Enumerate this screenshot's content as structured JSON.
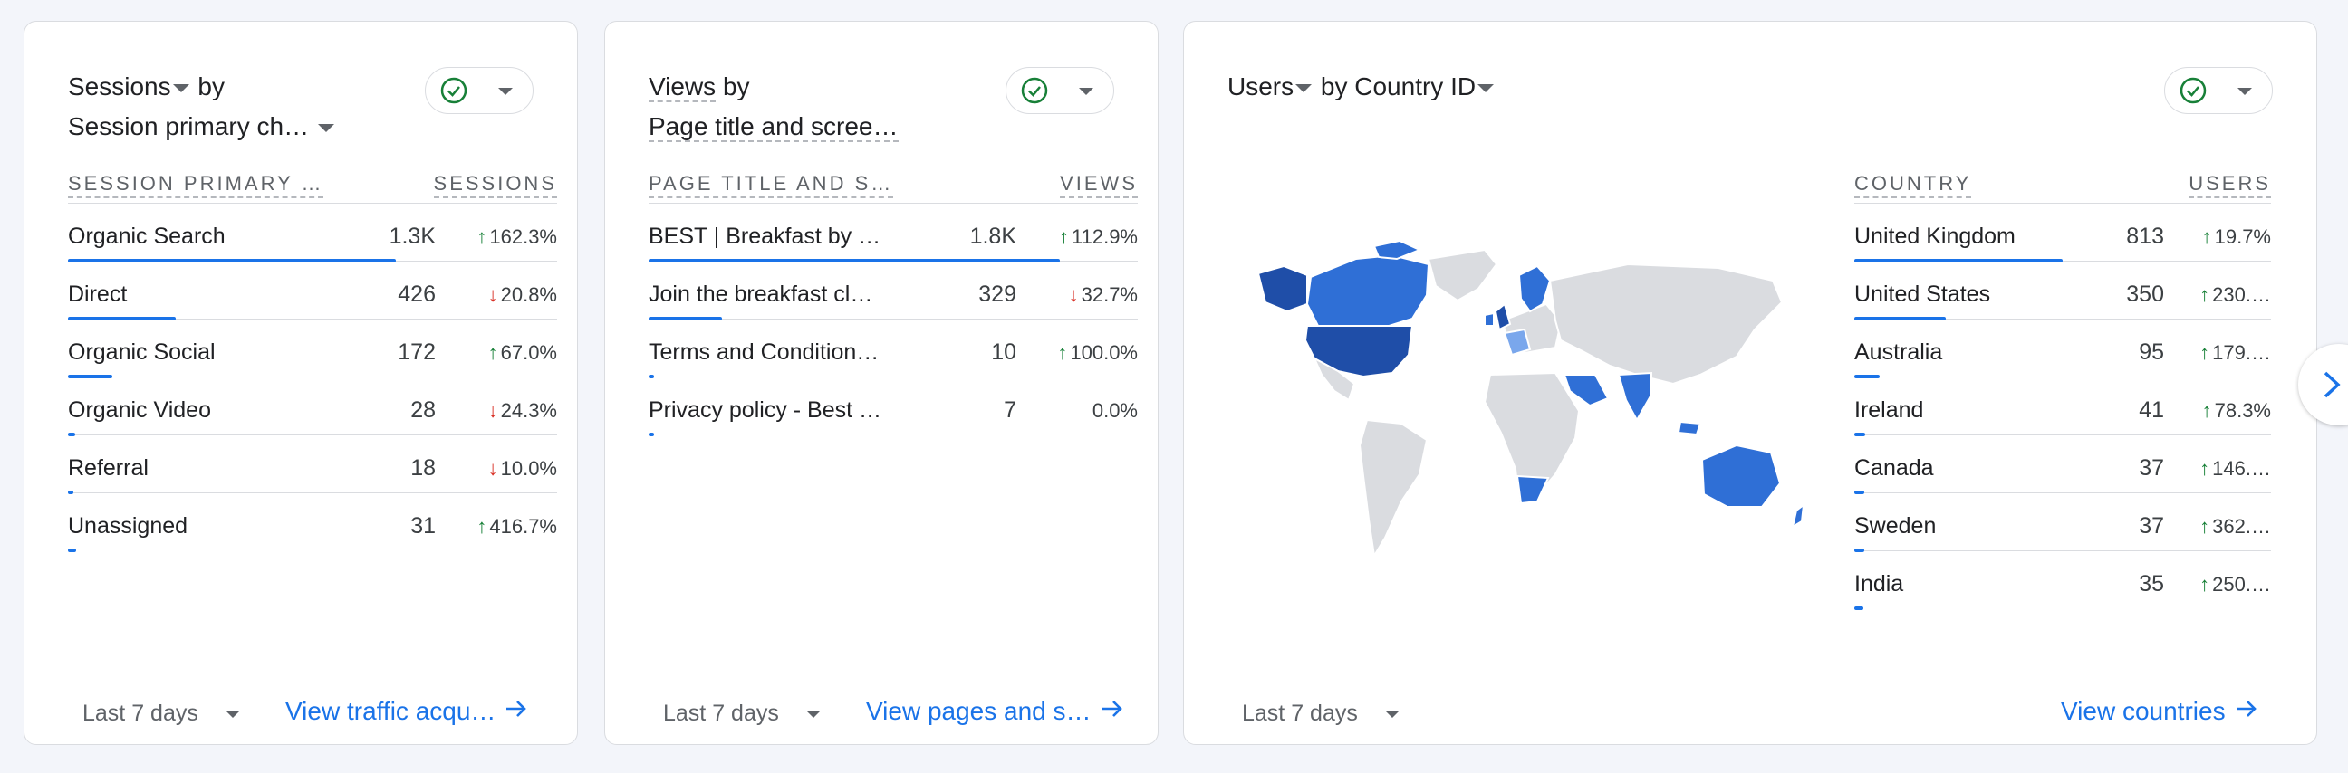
{
  "cards": [
    {
      "title_metric": "Sessions",
      "title_by": "by",
      "title_dimension": "Session primary ch…",
      "col_dim": "SESSION PRIMARY …",
      "col_metric": "SESSIONS",
      "rows": [
        {
          "name": "Organic Search",
          "value": "1.3K",
          "dir": "up",
          "change": "162.3%",
          "share": 0.67
        },
        {
          "name": "Direct",
          "value": "426",
          "dir": "down",
          "change": "20.8%",
          "share": 0.22
        },
        {
          "name": "Organic Social",
          "value": "172",
          "dir": "up",
          "change": "67.0%",
          "share": 0.09
        },
        {
          "name": "Organic Video",
          "value": "28",
          "dir": "down",
          "change": "24.3%",
          "share": 0.015
        },
        {
          "name": "Referral",
          "value": "18",
          "dir": "down",
          "change": "10.0%",
          "share": 0.01
        },
        {
          "name": "Unassigned",
          "value": "31",
          "dir": "up",
          "change": "416.7%",
          "share": 0.016
        }
      ],
      "range_label": "Last 7 days",
      "link_label": "View traffic acqu…"
    },
    {
      "title_metric": "Views",
      "title_by": "by",
      "title_dimension": "Page title and scree…",
      "col_dim": "PAGE TITLE AND S…",
      "col_metric": "VIEWS",
      "rows": [
        {
          "name": "BEST | Breakfast by …",
          "value": "1.8K",
          "dir": "up",
          "change": "112.9%",
          "share": 0.84
        },
        {
          "name": "Join the breakfast cl…",
          "value": "329",
          "dir": "down",
          "change": "32.7%",
          "share": 0.15
        },
        {
          "name": "Terms and Condition…",
          "value": "10",
          "dir": "up",
          "change": "100.0%",
          "share": 0.005
        },
        {
          "name": "Privacy policy - Best …",
          "value": "7",
          "dir": "none",
          "change": "0.0%",
          "share": 0.004
        }
      ],
      "range_label": "Last 7 days",
      "link_label": "View pages and s…"
    },
    {
      "title_metric": "Users",
      "title_by": "by",
      "title_dimension": "Country ID",
      "col_dim": "COUNTRY",
      "col_metric": "USERS",
      "rows": [
        {
          "name": "United Kingdom",
          "value": "813",
          "dir": "up",
          "change": "19.7%",
          "share": 0.5
        },
        {
          "name": "United States",
          "value": "350",
          "dir": "up",
          "change": "230.…",
          "share": 0.22
        },
        {
          "name": "Australia",
          "value": "95",
          "dir": "up",
          "change": "179.…",
          "share": 0.06
        },
        {
          "name": "Ireland",
          "value": "41",
          "dir": "up",
          "change": "78.3%",
          "share": 0.025
        },
        {
          "name": "Canada",
          "value": "37",
          "dir": "up",
          "change": "146.…",
          "share": 0.023
        },
        {
          "name": "Sweden",
          "value": "37",
          "dir": "up",
          "change": "362.…",
          "share": 0.023
        },
        {
          "name": "India",
          "value": "35",
          "dir": "up",
          "change": "250.…",
          "share": 0.022
        }
      ],
      "range_label": "Last 7 days",
      "link_label": "View countries"
    }
  ],
  "colors": {
    "accent": "#1a73e8",
    "up": "#188038",
    "down": "#d93025",
    "map_dark": "#1f4ea8",
    "map_mid": "#2f6fd6",
    "map_light": "#7aa7ec",
    "map_empty": "#dadce0"
  },
  "icons": [
    "check-circle-icon",
    "chevron-down-icon",
    "arrow-right-icon",
    "chevron-right-icon",
    "arrow-up-icon",
    "arrow-down-icon"
  ]
}
